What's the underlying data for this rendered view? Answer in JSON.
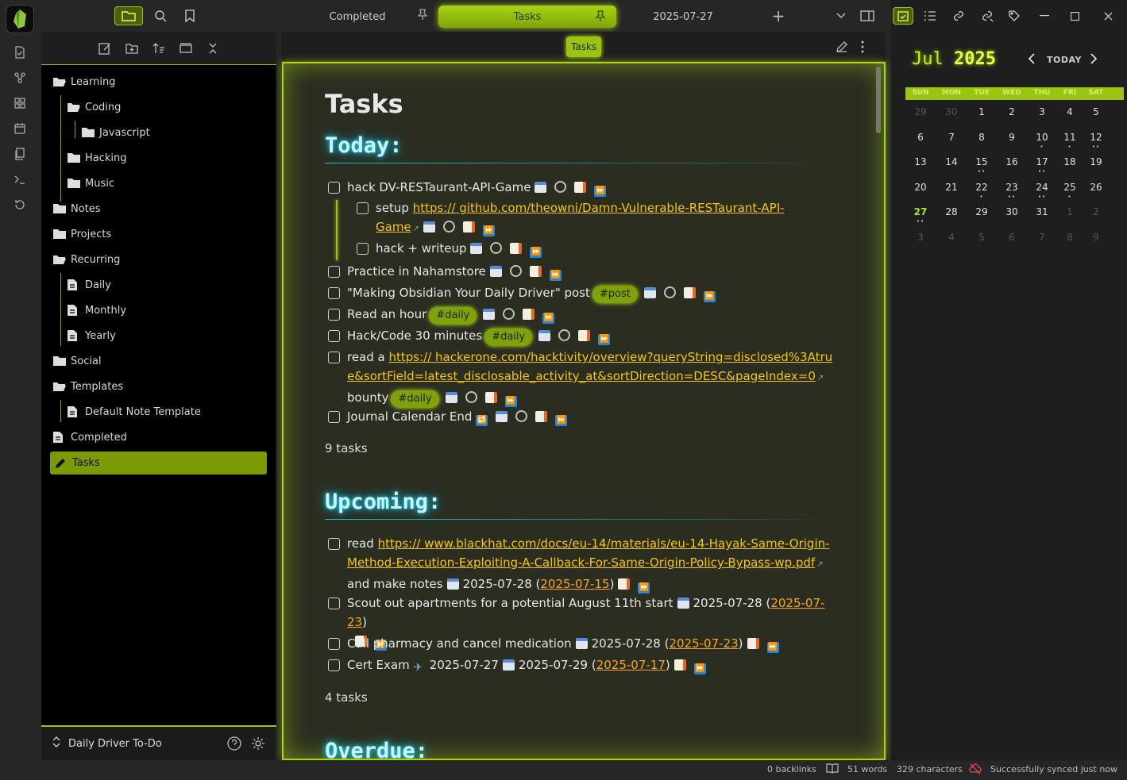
{
  "topbar": {
    "tabs": [
      {
        "label": "Completed"
      },
      {
        "label": "Tasks"
      },
      {
        "label": "2025-07-27"
      }
    ],
    "new_tab": "+"
  },
  "sidebar": {
    "items": [
      {
        "label": "Learning",
        "type": "folder-open"
      },
      {
        "label": "Coding",
        "type": "folder-open"
      },
      {
        "label": "Javascript",
        "type": "folder"
      },
      {
        "label": "Hacking",
        "type": "folder"
      },
      {
        "label": "Music",
        "type": "folder"
      },
      {
        "label": "Notes",
        "type": "folder"
      },
      {
        "label": "Projects",
        "type": "folder"
      },
      {
        "label": "Recurring",
        "type": "folder-open"
      },
      {
        "label": "Daily",
        "type": "file"
      },
      {
        "label": "Monthly",
        "type": "file"
      },
      {
        "label": "Yearly",
        "type": "file"
      },
      {
        "label": "Social",
        "type": "folder"
      },
      {
        "label": "Templates",
        "type": "folder-open"
      },
      {
        "label": "Default Note Template",
        "type": "file"
      },
      {
        "label": "Completed",
        "type": "file"
      },
      {
        "label": "Tasks",
        "type": "file-edit"
      }
    ],
    "vault_name": "Daily Driver To-Do"
  },
  "main": {
    "view_title": "Tasks",
    "doc_title": "Tasks",
    "sections": {
      "today": "Today:",
      "upcoming": "Upcoming:",
      "overdue": "Overdue:"
    },
    "today_tasks": {
      "t1": "hack DV-RESTaurant-API-Game",
      "t1a_prefix": "setup ",
      "t1a_link": "https:// github.com/theowni/Damn-Vulnerable-RESTaurant-API-Game",
      "t1b": "hack + writeup",
      "t2": "Practice in Nahamstore",
      "t3": "\"Making Obsidian Your Daily Driver\" post",
      "t3_tag": "#post",
      "t4": "Read an hour",
      "t4_tag": "#daily",
      "t5": "Hack/Code 30 minutes",
      "t5_tag": "#daily",
      "t6_prefix": "read a ",
      "t6_link": "https:// hackerone.com/hacktivity/overview?queryString=disclosed%3Atrue&sortField=latest_disclosable_activity_at&sortDirection=DESC&pageIndex=0",
      "t6_suffix": " bounty",
      "t6_tag": "#daily",
      "t7": "Journal Calendar End"
    },
    "today_count": "9 tasks",
    "upcoming_tasks": {
      "u1_prefix": "read ",
      "u1_link": "https:// www.blackhat.com/docs/eu-14/materials/eu-14-Hayak-Same-Origin-Method-Execution-Exploiting-A-Callback-For-Same-Origin-Policy-Bypass-wp.pdf",
      "u1_suffix": " and make notes",
      "u1_due": "2025-07-28",
      "u1_ref": "2025-07-15",
      "u2": "Scout out apartments for a potential August 11th start",
      "u2_due": "2025-07-28",
      "u2_ref": "2025-07-23",
      "u3": "Call pharmacy and cancel medication",
      "u3_due": "2025-07-28",
      "u3_ref": "2025-07-23",
      "u4": "Cert Exam",
      "u4_start": "2025-07-27",
      "u4_due": "2025-07-29",
      "u4_ref": "2025-07-17"
    },
    "upcoming_count": "4 tasks"
  },
  "calendar": {
    "month": "Jul",
    "year": "2025",
    "today_label": "TODAY",
    "weekdays": [
      "SUN",
      "MON",
      "TUE",
      "WED",
      "THU",
      "FRI",
      "SAT"
    ],
    "weeks": [
      [
        "29",
        "30",
        "1",
        "2",
        "3",
        "4",
        "5"
      ],
      [
        "6",
        "7",
        "8",
        "9",
        "10",
        "11",
        "12"
      ],
      [
        "13",
        "14",
        "15",
        "16",
        "17",
        "18",
        "19"
      ],
      [
        "20",
        "21",
        "22",
        "23",
        "24",
        "25",
        "26"
      ],
      [
        "27",
        "28",
        "29",
        "30",
        "31",
        "1",
        "2"
      ],
      [
        "3",
        "4",
        "5",
        "6",
        "7",
        "8",
        "9"
      ]
    ]
  },
  "status": {
    "backlinks": "0 backlinks",
    "words": "51 words",
    "characters": "329 characters",
    "sync": "Successfully synced just now"
  },
  "colors": {
    "accent": "#9bc412",
    "heading_glow": "#22d3ee",
    "link": "#f5c518"
  }
}
